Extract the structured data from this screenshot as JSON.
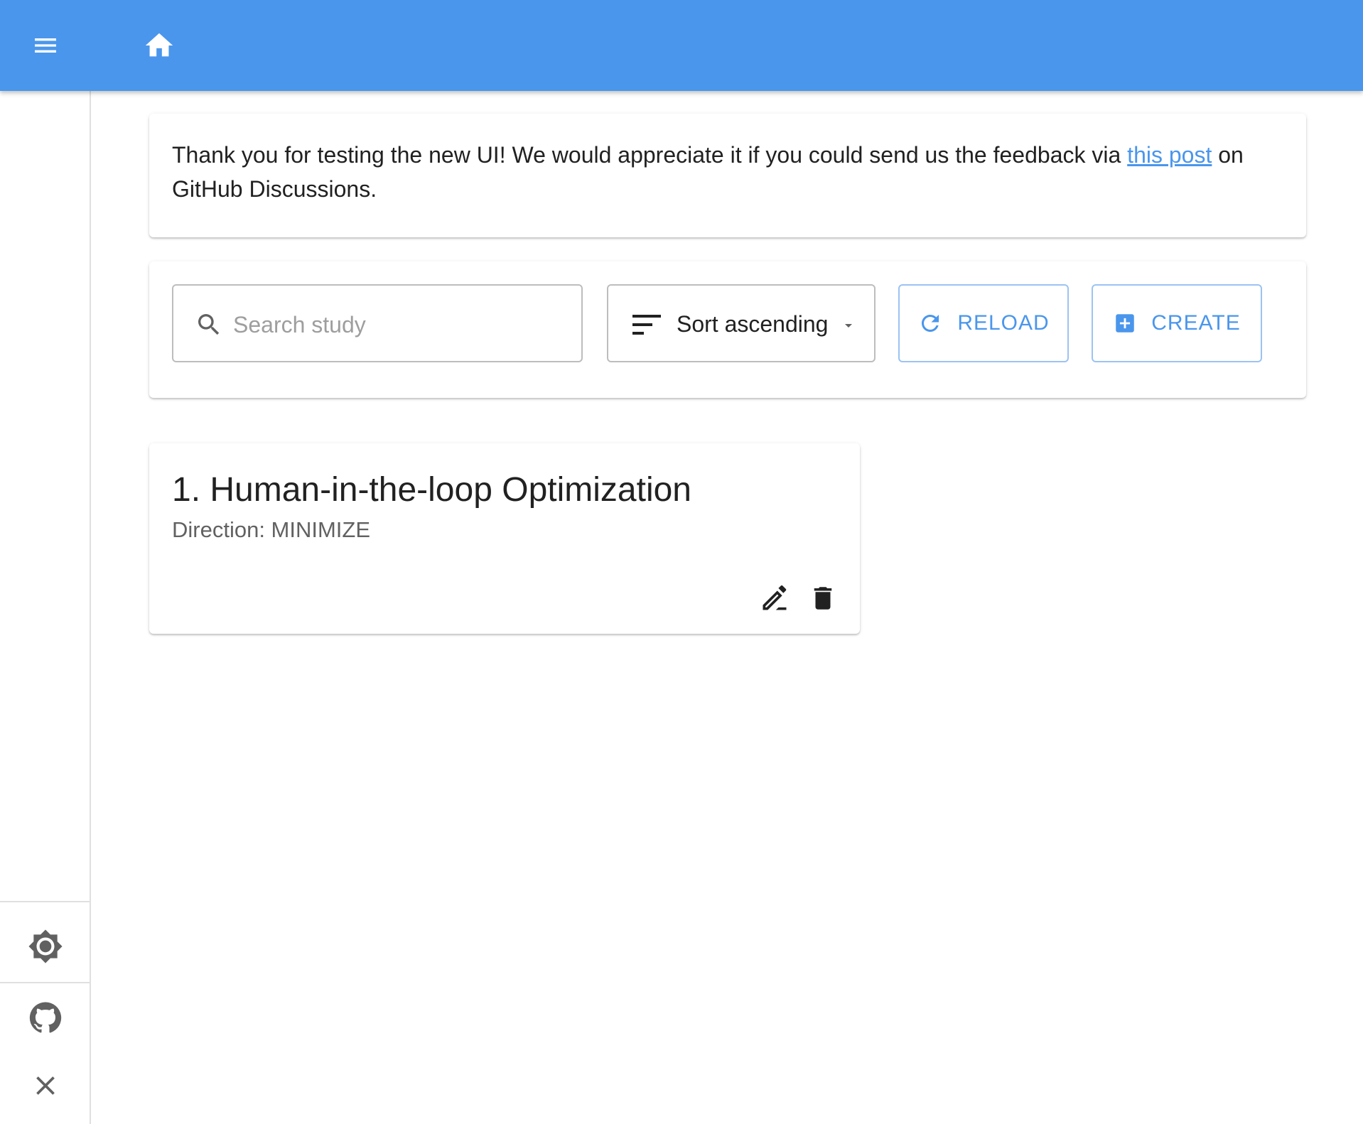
{
  "appbar": {
    "color": "#4a96ec",
    "menu_icon": "menu-icon",
    "home_icon": "home-icon"
  },
  "notice": {
    "text_before": "Thank you for testing the new UI! We would appreciate it if you could send us the feedback via ",
    "link_text": "this post",
    "text_after": " on GitHub Discussions."
  },
  "toolbar": {
    "search": {
      "placeholder": "Search study",
      "value": ""
    },
    "sort": {
      "label": "Sort ascending"
    },
    "reload_label": "RELOAD",
    "create_label": "CREATE"
  },
  "studies": [
    {
      "title": "1. Human-in-the-loop Optimization",
      "direction": "Direction: MINIMIZE"
    }
  ],
  "sidebar": {
    "icons": [
      "brightness-icon",
      "github-icon",
      "close-icon"
    ]
  }
}
